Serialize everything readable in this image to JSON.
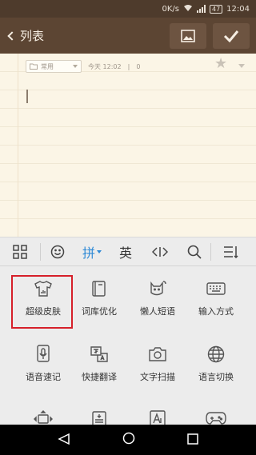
{
  "status_bar": {
    "network_speed": "0K/s",
    "battery": "47",
    "time": "12:04"
  },
  "app_bar": {
    "back_label": "列表",
    "image_icon": "image-icon",
    "confirm_icon": "checkmark-icon"
  },
  "note": {
    "category": "常用",
    "date": "今天 12:02",
    "count": "0"
  },
  "keyboard": {
    "toolbar": [
      {
        "name": "grid-menu-icon",
        "label": ""
      },
      {
        "name": "emoji-icon",
        "label": ""
      },
      {
        "name": "pinyin-mode",
        "label": "拼"
      },
      {
        "name": "english-mode",
        "label": "英"
      },
      {
        "name": "cursor-move-icon",
        "label": ""
      },
      {
        "name": "search-icon",
        "label": ""
      },
      {
        "name": "collapse-keyboard-icon",
        "label": ""
      }
    ],
    "grid": [
      {
        "label": "超级皮肤",
        "icon": "tshirt-icon"
      },
      {
        "label": "词库优化",
        "icon": "book-icon"
      },
      {
        "label": "懒人短语",
        "icon": "cat-icon"
      },
      {
        "label": "输入方式",
        "icon": "keyboard-icon"
      },
      {
        "label": "语音速记",
        "icon": "microphone-icon"
      },
      {
        "label": "快捷翻译",
        "icon": "translate-icon"
      },
      {
        "label": "文字扫描",
        "icon": "camera-icon"
      },
      {
        "label": "语言切换",
        "icon": "globe-icon"
      },
      {
        "label": "",
        "icon": "cursor-keys-icon"
      },
      {
        "label": "",
        "icon": "clipboard-icon"
      },
      {
        "label": "",
        "icon": "font-icon"
      },
      {
        "label": "",
        "icon": "gamepad-icon"
      }
    ],
    "highlight_color": "#d6202a",
    "accent_color": "#2f8ad6"
  },
  "nav_bar": {
    "back_icon": "nav-back-icon",
    "home_icon": "nav-home-icon",
    "recents_icon": "nav-recents-icon"
  },
  "colors": {
    "app_bar": "#5c4533",
    "status_bar": "#4e3b2c",
    "paper": "#fbf5e6"
  }
}
